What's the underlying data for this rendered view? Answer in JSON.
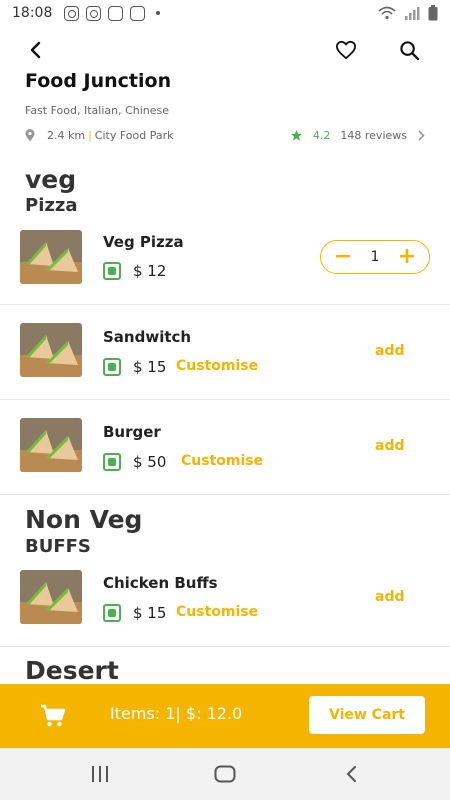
{
  "status_bar": {
    "time": "18:08"
  },
  "restaurant": {
    "name": "Food Junction",
    "cuisines": "Fast Food, Italian, Chinese",
    "distance": "2.4 km",
    "separator": "|",
    "location": "City Food Park",
    "rating": "4.2",
    "reviews": "148 reviews"
  },
  "sections": [
    {
      "title": "veg",
      "subsection": "Pizza",
      "items": [
        {
          "name": "Veg Pizza",
          "price": "$ 12",
          "quantity": "1"
        }
      ]
    },
    {
      "items": [
        {
          "name": "Sandwitch",
          "price": "$ 15",
          "customise": "Customise",
          "action": "add"
        },
        {
          "name": "Burger",
          "price": "$ 50",
          "customise": "Customise",
          "action": "add"
        }
      ]
    },
    {
      "title": "Non Veg",
      "subsection": "BUFFS",
      "items": [
        {
          "name": "Chicken Buffs",
          "price": "$ 15",
          "customise": "Customise",
          "action": "add"
        }
      ]
    },
    {
      "title": "Desert"
    }
  ],
  "stepper": {
    "minus": "−",
    "plus": "+"
  },
  "cart": {
    "summary": "Items: 1| $: 12.0",
    "button": "View Cart"
  },
  "colors": {
    "accent": "#f5b400",
    "veg": "#4caf50"
  },
  "icons": [
    "back-arrow-icon",
    "heart-icon",
    "search-icon",
    "location-pin-icon",
    "star-icon",
    "chevron-right-icon",
    "cart-icon",
    "recents-icon",
    "home-icon",
    "back-icon"
  ]
}
